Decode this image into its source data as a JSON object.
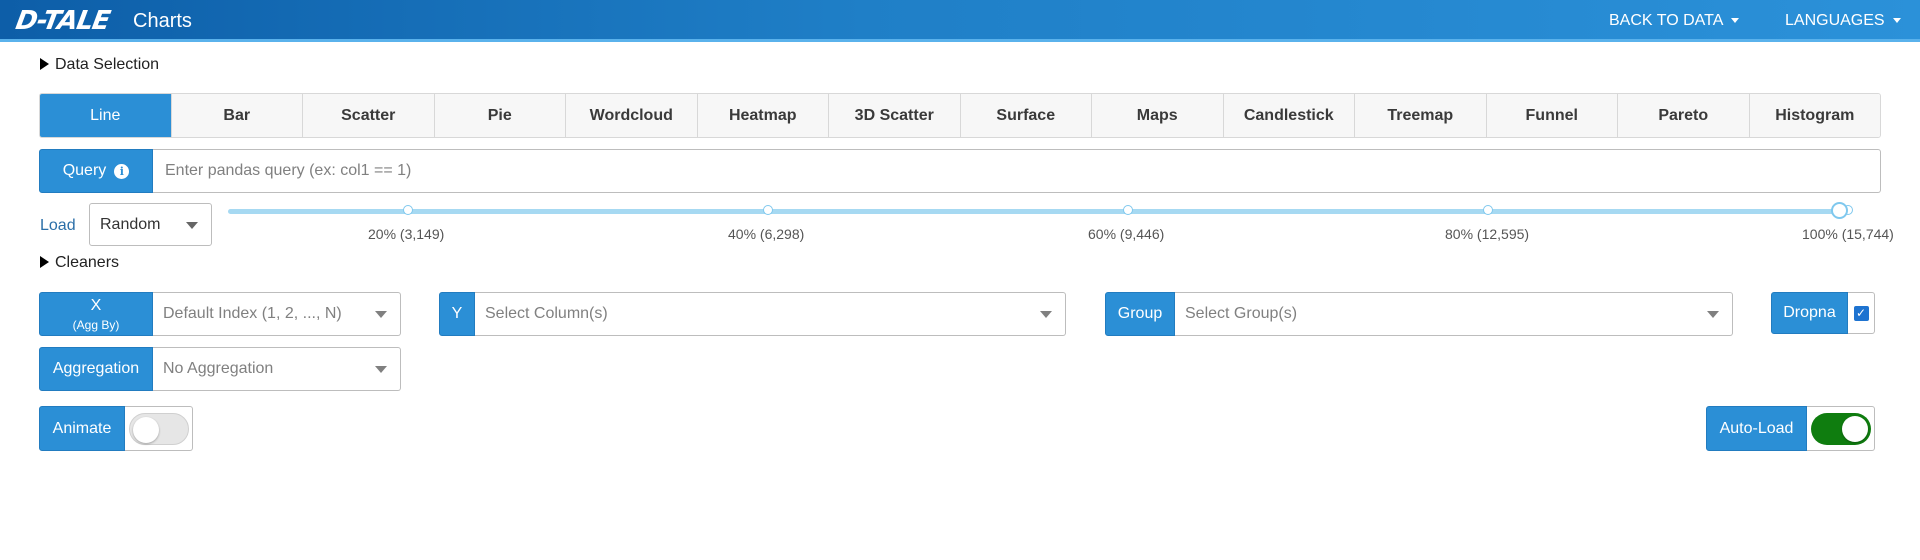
{
  "navbar": {
    "logo": "D-TALE",
    "title": "Charts",
    "back_to_data": "BACK TO DATA",
    "languages": "LANGUAGES"
  },
  "data_selection": {
    "label": "Data Selection"
  },
  "chart_tabs": [
    "Line",
    "Bar",
    "Scatter",
    "Pie",
    "Wordcloud",
    "Heatmap",
    "3D Scatter",
    "Surface",
    "Maps",
    "Candlestick",
    "Treemap",
    "Funnel",
    "Pareto",
    "Histogram"
  ],
  "active_tab": "Line",
  "query": {
    "label": "Query",
    "placeholder": "Enter pandas query (ex: col1 == 1)",
    "value": ""
  },
  "load": {
    "label": "Load",
    "value": "Random",
    "slider_value_percent": 100,
    "marks": [
      "20% (3,149)",
      "40% (6,298)",
      "60% (9,446)",
      "80% (12,595)",
      "100% (15,744)"
    ]
  },
  "cleaners": {
    "label": "Cleaners"
  },
  "x": {
    "label": "X",
    "sublabel": "(Agg By)",
    "placeholder": "Default Index (1, 2, ..., N)"
  },
  "y": {
    "label": "Y",
    "placeholder": "Select Column(s)"
  },
  "group": {
    "label": "Group",
    "placeholder": "Select Group(s)"
  },
  "dropna": {
    "label": "Dropna",
    "checked": true
  },
  "aggregation": {
    "label": "Aggregation",
    "value": "No Aggregation"
  },
  "animate": {
    "label": "Animate",
    "on": false
  },
  "auto_load": {
    "label": "Auto-Load",
    "on": true
  },
  "colors": {
    "primary": "#2b8fd6",
    "toggle_on": "#0f7d0f",
    "slider_rail": "#a6d9f2"
  },
  "icons": {
    "query_info": "info-icon",
    "dropna_check": "checkmark-icon"
  }
}
